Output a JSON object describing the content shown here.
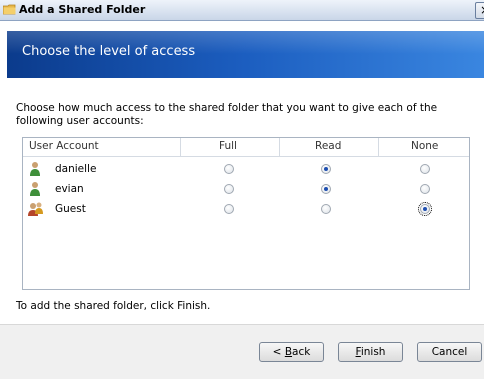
{
  "window": {
    "title": "Add a Shared Folder",
    "close_glyph": "×"
  },
  "banner": {
    "title": "Choose the level of access"
  },
  "instruction": "Choose how much access to the shared folder that you want to give each of the following user accounts:",
  "table": {
    "columns": [
      "User Account",
      "Full",
      "Read",
      "None"
    ],
    "rows": [
      {
        "name": "danielle",
        "icon": "user-icon",
        "access": "Read"
      },
      {
        "name": "evian",
        "icon": "user-icon",
        "access": "Read"
      },
      {
        "name": "Guest",
        "icon": "guest-user-icon",
        "access": "None"
      }
    ]
  },
  "footer_text": "To add the shared folder, click Finish.",
  "buttons": {
    "back": {
      "mnemonic": "B",
      "rest": "ack",
      "prefix": "< "
    },
    "finish": {
      "mnemonic": "F",
      "rest": "inish"
    },
    "cancel": {
      "label": "Cancel"
    }
  },
  "colors": {
    "banner_start": "#0b3b8c",
    "banner_end": "#3a86e0",
    "radio_selected": "#1e4fb0"
  }
}
